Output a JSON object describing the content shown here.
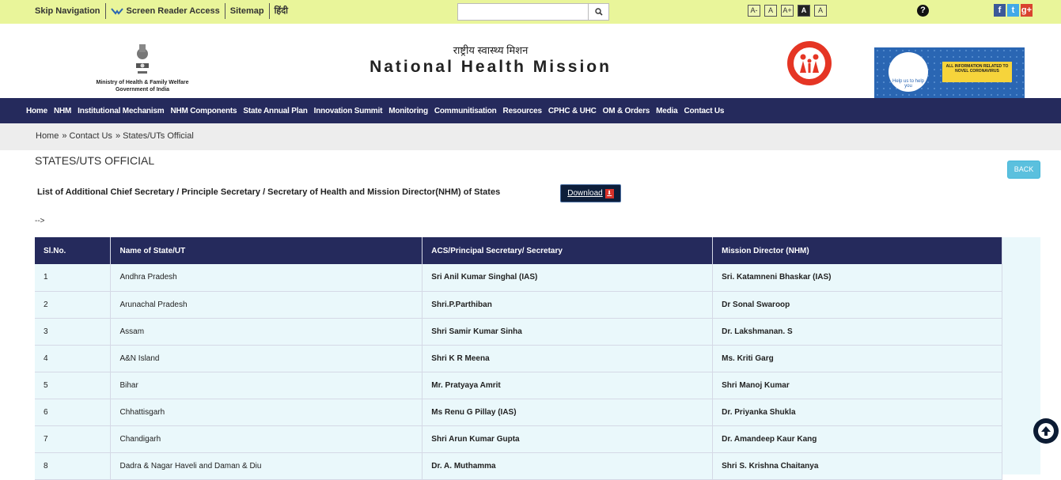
{
  "topbar": {
    "links": [
      "Skip Navigation",
      "Screen Reader Access",
      "Sitemap",
      "हिंदी"
    ],
    "search_placeholder": "",
    "font_sizes": [
      "A-",
      "A",
      "A+",
      "A",
      "A"
    ],
    "social": [
      "f",
      "t",
      "g+"
    ]
  },
  "header": {
    "ministry_line1": "Ministry of Health & Family Welfare",
    "ministry_line2": "Government of India",
    "title_hindi": "राष्ट्रीय स्वास्थ्य मिशन",
    "title_english": "National Health Mission",
    "banner_help": "Help us to help you",
    "banner_info": "ALL INFORMATION RELATED TO NOVEL CORONAVIRUS"
  },
  "nav": {
    "items": [
      "Home",
      "NHM",
      "Institutional Mechanism",
      "NHM Components",
      "State Annual Plan",
      "Innovation Summit",
      "Monitoring",
      "Communitisation",
      "Resources",
      "CPHC & UHC",
      "OM & Orders",
      "Media",
      "Contact Us"
    ]
  },
  "breadcrumb": {
    "home": "Home",
    "contact": "» Contact Us",
    "current": "» States/UTs Official"
  },
  "page": {
    "title": "STATES/UTS OFFICIAL",
    "back_label": "BACK",
    "description": "List of Additional Chief Secretary / Principle Secretary / Secretary of Health and Mission Director(NHM) of States",
    "download_label": "Download",
    "stray_text": "-->"
  },
  "table": {
    "headers": [
      "Sl.No.",
      "Name of State/UT",
      "ACS/Principal Secretary/ Secretary",
      "Mission Director (NHM)"
    ],
    "rows": [
      [
        "1",
        "Andhra Pradesh",
        "Sri Anil Kumar Singhal (IAS)",
        "Sri. Katamneni Bhaskar (IAS)"
      ],
      [
        "2",
        "Arunachal Pradesh",
        "Shri.P.Parthiban",
        "Dr Sonal Swaroop"
      ],
      [
        "3",
        "Assam",
        "Shri Samir Kumar Sinha",
        "Dr. Lakshmanan. S"
      ],
      [
        "4",
        "A&N Island",
        "Shri K R Meena",
        "Ms. Kriti Garg"
      ],
      [
        "5",
        "Bihar",
        "Mr. Pratyaya Amrit",
        "Shri Manoj Kumar"
      ],
      [
        "6",
        "Chhattisgarh",
        "Ms Renu G Pillay (IAS)",
        "Dr. Priyanka Shukla"
      ],
      [
        "7",
        "Chandigarh",
        "Shri Arun Kumar Gupta",
        "Dr. Amandeep Kaur Kang"
      ],
      [
        "8",
        "Dadra & Nagar Haveli and Daman & Diu",
        "Dr. A. Muthamma",
        "Shri S. Krishna Chaitanya"
      ]
    ]
  },
  "colors": {
    "topbar_bg": "#e9f59a",
    "nav_bg": "#252a5c",
    "row_bg": "#eaf8fb",
    "back_button": "#5bc0de"
  }
}
